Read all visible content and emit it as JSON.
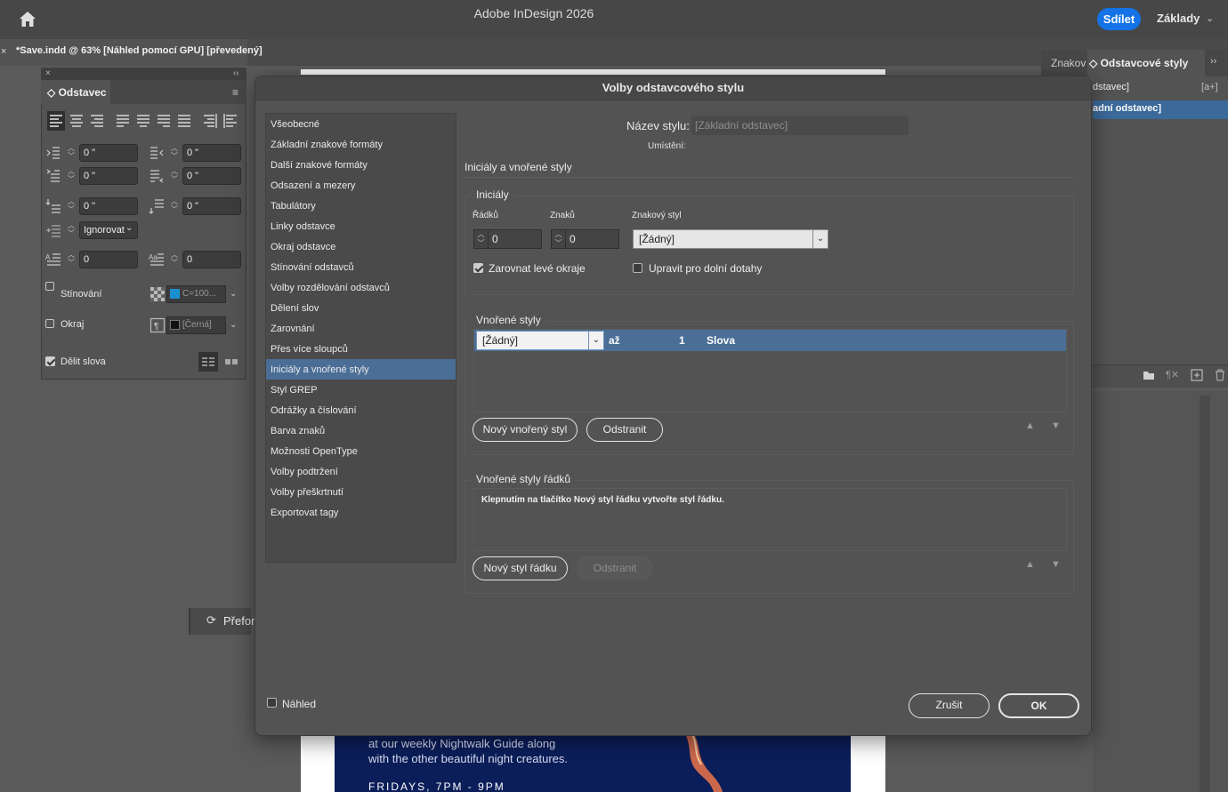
{
  "app": {
    "title": "Adobe InDesign 2026",
    "share_label": "Sdílet",
    "workspace_label": "Základy",
    "home_icon": "home-icon"
  },
  "document_tab": {
    "label": "*Save.indd @ 63% [Náhled pomocí GPU] [převedený]",
    "close_glyph": "×"
  },
  "page_content": {
    "line1": "at our weekly Nightwalk Guide along",
    "line2": "with the other beautiful night creatures.",
    "line3": "FRIDAYS, 7PM - 9PM"
  },
  "paragraph_panel": {
    "close_glyph": "×",
    "collapse_glyph": "‹‹",
    "title": "◇ Odstavec",
    "left_indent": "0 \"",
    "right_indent": "0 \"",
    "first_line_indent": "0 \"",
    "last_line_indent": "0 \"",
    "space_before": "0 \"",
    "space_after": "0 \"",
    "align_to_grid": "Ignorovat",
    "drop_cap_lines": "0",
    "drop_cap_chars": "0",
    "shading_label": "Stínování",
    "shading_swatch": "C=100...",
    "border_label": "Okraj",
    "border_swatch": "[Černá]",
    "hyphenate_label": "Dělit slova",
    "hyphenate_checked": true,
    "accent_color": "#1a8fd0"
  },
  "styles_panel": {
    "tab_character": "Znakov",
    "tab_paragraph": "◇ Odstavcové styly",
    "more_glyph": "››",
    "row1": "dstavec]",
    "row1_icon": "[a+]",
    "row2": "adní odstavec]",
    "selection_color": "#3b6a9a"
  },
  "reformat": {
    "label": "Přefor",
    "icon": "refresh-icon"
  },
  "dialog": {
    "title": "Volby odstavcového stylu",
    "categories": [
      "Všeobecné",
      "Základní znakové formáty",
      "Další znakové formáty",
      "Odsazení a mezery",
      "Tabulátory",
      "Linky odstavce",
      "Okraj odstavce",
      "Stínování odstavců",
      "Volby rozdělování odstavců",
      "Dělení slov",
      "Zarovnání",
      "Přes více sloupců",
      "Iniciály a vnořené styly",
      "Styl GREP",
      "Odrážky a číslování",
      "Barva znaků",
      "Možnosti OpenType",
      "Volby podtržení",
      "Volby přeškrtnutí",
      "Exportovat tagy"
    ],
    "selected_category": "Iniciály a vnořené styly",
    "style_name_label": "Název stylu:",
    "style_name_value": "[Základní odstavec]",
    "location_label": "Umístění:",
    "section_heading": "Iniciály a vnořené styly",
    "drop_caps": {
      "title": "Iniciály",
      "lines_label": "Řádků",
      "lines_value": "0",
      "chars_label": "Znaků",
      "chars_value": "0",
      "char_style_label": "Znakový styl",
      "char_style_value": "[Žádný]",
      "align_left_label": "Zarovnat levé okraje",
      "align_left_checked": true,
      "scale_descenders_label": "Upravit pro dolní dotahy",
      "scale_descenders_checked": false
    },
    "nested_styles": {
      "title": "Vnořené styly",
      "row": {
        "style": "[Žádný]",
        "through": "až",
        "count": "1",
        "unit": "Slova"
      },
      "new_button": "Nový vnořený styl",
      "delete_button": "Odstranit"
    },
    "nested_line_styles": {
      "title": "Vnořené styly řádků",
      "info": "Klepnutím na tlačítko Nový styl řádku vytvořte styl řádku.",
      "new_button": "Nový styl řádku",
      "delete_button": "Odstranit"
    },
    "preview_label": "Náhled",
    "preview_checked": false,
    "cancel_button": "Zrušit",
    "ok_button": "OK",
    "selection_color": "#4a6e96"
  }
}
